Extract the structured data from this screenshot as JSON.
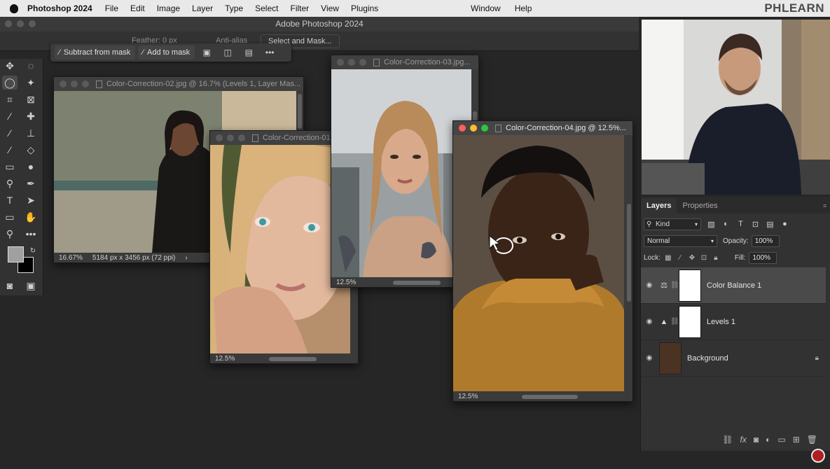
{
  "menubar": {
    "app": "Photoshop 2024",
    "items": [
      "File",
      "Edit",
      "Image",
      "Layer",
      "Type",
      "Select",
      "Filter",
      "View",
      "Plugins"
    ],
    "right_items": [
      "Window",
      "Help"
    ],
    "brand": "PHLEARN"
  },
  "window_title": "Adobe Photoshop 2024",
  "options_bar": {
    "feather_label": "Feather:",
    "feather_value": "0 px",
    "antialias": "Anti-alias",
    "select_mask": "Select and Mask..."
  },
  "mask_bar": {
    "subtract": "Subtract from mask",
    "add": "Add to mask"
  },
  "documents": {
    "doc2": {
      "title": "Color-Correction-02.jpg @ 16.7% (Levels 1, Layer Mas...",
      "zoom": "16.67%",
      "size": "5184 px x 3456 px (72 ppi)"
    },
    "doc1": {
      "title": "Color-Correction-01",
      "zoom": "12.5%"
    },
    "doc3": {
      "title": "Color-Correction-03.jpg...",
      "zoom": "12.5%"
    },
    "doc4": {
      "title": "Color-Correction-04.jpg @ 12.5%...",
      "zoom": "12.5%"
    }
  },
  "layers_panel": {
    "tabs": [
      "Layers",
      "Properties"
    ],
    "kind": "Kind",
    "blend_mode": "Normal",
    "opacity_label": "Opacity:",
    "opacity": "100%",
    "lock_label": "Lock:",
    "fill_label": "Fill:",
    "fill": "100%",
    "layers": [
      {
        "name": "Color Balance 1",
        "type": "adjustment",
        "selected": true
      },
      {
        "name": "Levels 1",
        "type": "adjustment",
        "selected": false
      },
      {
        "name": "Background",
        "type": "image",
        "selected": false,
        "locked": true
      }
    ]
  },
  "colors": {
    "accent": "#e9e9ea",
    "panel": "#323232",
    "canvas": "#262626"
  }
}
